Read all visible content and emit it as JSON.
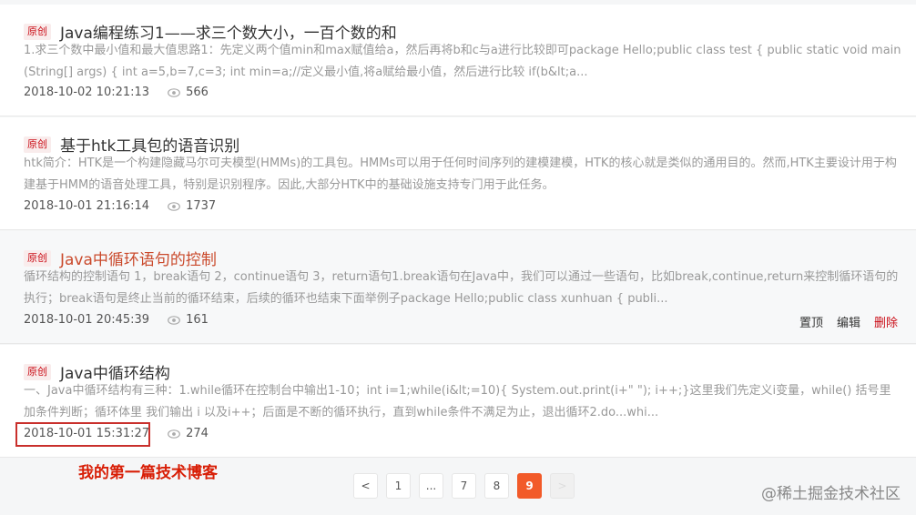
{
  "articles": [
    {
      "badge": "原创",
      "title": "Java编程练习1——求三个数大小，一百个数的和",
      "desc": "1.求三个数中最小值和最大值思路1：先定义两个值min和max赋值给a，然后再将b和c与a进行比较即可package Hello;public class test { public static void main(String[] args) { int a=5,b=7,c=3; int min=a;//定义最小值,将a赋给最小值，然后进行比较 if(b&lt;a...",
      "date": "2018-10-02 10:21:13",
      "views": "566"
    },
    {
      "badge": "原创",
      "title": "基于htk工具包的语音识别",
      "desc": "htk简介：HTK是一个构建隐藏马尔可夫模型(HMMs)的工具包。HMMs可以用于任何时间序列的建模建模，HTK的核心就是类似的通用目的。然而,HTK主要设计用于构建基于HMM的语音处理工具，特别是识别程序。因此,大部分HTK中的基础设施支持专门用于此任务。——————————————————————————————",
      "date": "2018-10-01 21:16:14",
      "views": "1737"
    },
    {
      "badge": "原创",
      "title": "Java中循环语句的控制",
      "desc": "循环结构的控制语句 1，break语句 2，continue语句 3，return语句1.break语句在Java中，我们可以通过一些语句，比如break,continue,return来控制循环语句的执行；break语句是终止当前的循环结束，后续的循环也结束下面举例子package Hello;public class xunhuan { publi...",
      "date": "2018-10-01 20:45:39",
      "views": "161",
      "ops": {
        "top": "置顶",
        "edit": "编辑",
        "delete": "删除"
      }
    },
    {
      "badge": "原创",
      "title": "Java中循环结构",
      "desc": "一、Java中循环结构有三种：1.while循环在控制台中输出1-10；int i=1;while(i&lt;=10){ System.out.print(i+\" \"); i++;}这里我们先定义i变量，while() 括号里加条件判断；循环体里 我们输出 i 以及i++；后面是不断的循环执行，直到while条件不满足为止，退出循环2.do...whi...",
      "date": "2018-10-01 15:31:27",
      "views": "274"
    }
  ],
  "annotation": "我的第一篇技术博客",
  "pagination": {
    "prev": "<",
    "pages": [
      "1",
      "...",
      "7",
      "8",
      "9"
    ],
    "current": "9",
    "next": ">"
  },
  "watermark": "@稀土掘金技术社区",
  "colors": {
    "accent": "#f25a29",
    "badge": "#ca0c16",
    "highlight_box": "#c9302c"
  }
}
